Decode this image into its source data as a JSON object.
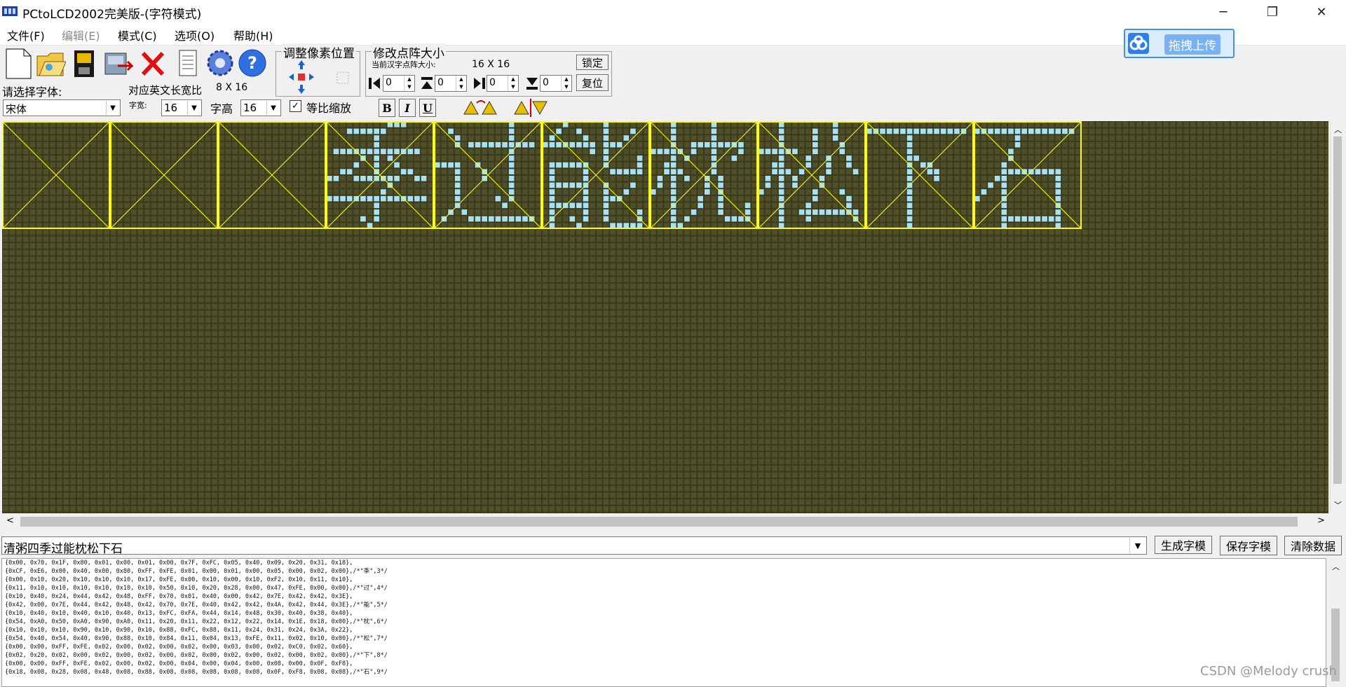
{
  "window": {
    "title": "PCtoLCD2002完美版-(字符模式)"
  },
  "menu": [
    {
      "label": "文件(F)",
      "disabled": false
    },
    {
      "label": "编辑(E)",
      "disabled": true
    },
    {
      "label": "模式(C)",
      "disabled": false
    },
    {
      "label": "选项(O)",
      "disabled": false
    },
    {
      "label": "帮助(H)",
      "disabled": false
    }
  ],
  "upload_badge": "拖拽上传",
  "toolbar": {
    "adjust_pixel_title": "调整像素位置",
    "resize_title": "修改点阵大小",
    "current_size_label": "当前汉字点阵大小:",
    "current_size": "16 X 16",
    "lock_button": "锁定",
    "reset_button": "复位",
    "spin_values": [
      "0",
      "0",
      "0",
      "0"
    ]
  },
  "font": {
    "select_label": "请选择字体:",
    "font_value": "宋体",
    "english_ratio_label": "对应英文长宽比",
    "english_ratio": "8 X 16",
    "width_label": "字宽:",
    "width_value": "16",
    "height_label": "字高",
    "height_value": "16",
    "proportional_label": "等比缩放",
    "bold": "B",
    "italic": "I",
    "underline": "U"
  },
  "colors": {
    "grid_bg": "#3a3a1a",
    "grid_cell": "#4f4f2a",
    "pixel_on": "#a8e0f4",
    "guide": "#ffff00"
  },
  "input_text": "清粥四季过能枕松下石",
  "buttons": {
    "generate": "生成字模",
    "save": "保存字模",
    "clear": "清除数据"
  },
  "output_lines": [
    "{0x00, 0x70, 0x1F, 0x80, 0x01, 0x00, 0x01, 0x00, 0x7F, 0xFC, 0x05, 0x40, 0x09, 0x20, 0x31, 0x18},",
    "{0xCF, 0xE6, 0x00, 0x40, 0x00, 0x80, 0xFF, 0xFE, 0x01, 0x00, 0x01, 0x00, 0x05, 0x00, 0x02, 0x00},/*\"季\",3*/",
    "{0x00, 0x10, 0x20, 0x10, 0x10, 0x10, 0x17, 0xFE, 0x00, 0x10, 0x00, 0x10, 0xF2, 0x10, 0x11, 0x10},",
    "{0x11, 0x10, 0x10, 0x10, 0x10, 0x10, 0x10, 0x50, 0x10, 0x20, 0x28, 0x00, 0x47, 0xFE, 0x00, 0x00},/*\"过\",4*/",
    "{0x10, 0x40, 0x24, 0x44, 0x42, 0x48, 0xFF, 0x70, 0x01, 0x40, 0x00, 0x42, 0x7E, 0x42, 0x42, 0x3E},",
    "{0x42, 0x00, 0x7E, 0x44, 0x42, 0x48, 0x42, 0x70, 0x7E, 0x40, 0x42, 0x42, 0x4A, 0x42, 0x44, 0x3E},/*\"能\",5*/",
    "{0x10, 0x40, 0x10, 0x40, 0x10, 0x40, 0x13, 0xFC, 0xFA, 0x44, 0x14, 0x48, 0x30, 0x40, 0x38, 0x40},",
    "{0x54, 0xA0, 0x50, 0xA0, 0x90, 0xA0, 0x11, 0x20, 0x11, 0x22, 0x12, 0x22, 0x14, 0x1E, 0x18, 0x00},/*\"枕\",6*/",
    "{0x10, 0x10, 0x10, 0x90, 0x10, 0x90, 0x10, 0x88, 0xFC, 0x88, 0x11, 0x24, 0x31, 0x24, 0x3A, 0x22},",
    "{0x54, 0x40, 0x54, 0x40, 0x90, 0x88, 0x10, 0x84, 0x11, 0x04, 0x13, 0xFE, 0x11, 0x02, 0x10, 0x00},/*\"松\",7*/",
    "{0x00, 0x00, 0xFF, 0xFE, 0x02, 0x00, 0x02, 0x00, 0x02, 0x00, 0x03, 0x00, 0x02, 0xC0, 0x02, 0x60},",
    "{0x02, 0x20, 0x02, 0x00, 0x02, 0x00, 0x02, 0x00, 0x02, 0x00, 0x02, 0x00, 0x02, 0x00, 0x02, 0x00},/*\"下\",8*/",
    "{0x00, 0x00, 0xFF, 0xFE, 0x02, 0x00, 0x02, 0x00, 0x04, 0x00, 0x04, 0x00, 0x08, 0x00, 0x0F, 0xF8},",
    "{0x18, 0x08, 0x28, 0x08, 0x48, 0x08, 0x88, 0x08, 0x08, 0x08, 0x08, 0x08, 0x0F, 0xF8, 0x08, 0x08},/*\"石\",9*/"
  ],
  "watermark": "CSDN @Melody crush"
}
